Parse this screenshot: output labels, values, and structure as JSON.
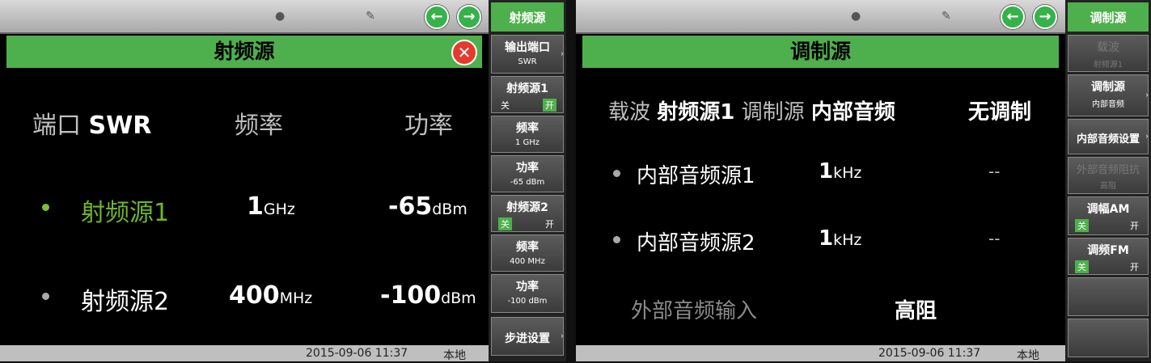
{
  "left_panel": {
    "title": "射频源",
    "close_glyph": "✕",
    "headers": {
      "port_label": "端口",
      "port_value": "SWR",
      "freq": "频率",
      "power": "功率"
    },
    "rows": [
      {
        "name": "射频源1",
        "freq_value": "1",
        "freq_unit": "GHz",
        "power_value": "-65",
        "power_unit": "dBm",
        "active": true
      },
      {
        "name": "射频源2",
        "freq_value": "400",
        "freq_unit": "MHz",
        "power_value": "-100",
        "power_unit": "dBm",
        "active": false
      }
    ],
    "status": {
      "datetime": "2015-09-06 11:37",
      "mode": "本地"
    }
  },
  "left_softkeys": {
    "header": "射频源",
    "output_port": {
      "label": "输出端口",
      "value": "SWR"
    },
    "rf1": {
      "label": "射频源1",
      "off": "关",
      "on": "开",
      "state": "on"
    },
    "rf1_freq": {
      "label": "频率",
      "value": "1 GHz"
    },
    "rf1_power": {
      "label": "功率",
      "value": "-65 dBm"
    },
    "rf2": {
      "label": "射频源2",
      "off": "关",
      "on": "开",
      "state": "off"
    },
    "rf2_freq": {
      "label": "频率",
      "value": "400 MHz"
    },
    "rf2_power": {
      "label": "功率",
      "value": "-100 dBm"
    },
    "step": {
      "label": "步进设置"
    }
  },
  "right_panel": {
    "title": "调制源",
    "summary": {
      "carrier_label": "载波",
      "carrier_value": "射频源1",
      "mod_label": "调制源",
      "mod_value": "内部音频",
      "mod_state": "无调制"
    },
    "rows": [
      {
        "name": "内部音频源1",
        "value": "1",
        "unit": "kHz",
        "extra": "--"
      },
      {
        "name": "内部音频源2",
        "value": "1",
        "unit": "kHz",
        "extra": "--"
      }
    ],
    "ext_input": {
      "label": "外部音频输入",
      "value": "高阻"
    },
    "status": {
      "datetime": "2015-09-06 11:37",
      "mode": "本地"
    }
  },
  "right_softkeys": {
    "header": "调制源",
    "carrier": {
      "label": "载波",
      "value": "射频源1"
    },
    "mod_source": {
      "label": "调制源",
      "value": "内部音频"
    },
    "internal_audio": {
      "label": "内部音频设置"
    },
    "ext_impedance": {
      "label": "外部音频阻抗",
      "value": "高阻"
    },
    "am": {
      "label": "调幅AM",
      "off": "关",
      "on": "开",
      "state": "off"
    },
    "fm": {
      "label": "调频FM",
      "off": "关",
      "on": "开",
      "state": "off"
    }
  },
  "nav": {
    "back": "←",
    "forward": "→"
  },
  "colors": {
    "accent": "#4eb04c",
    "active_text": "#6fb52c",
    "close": "#e53b2e"
  }
}
